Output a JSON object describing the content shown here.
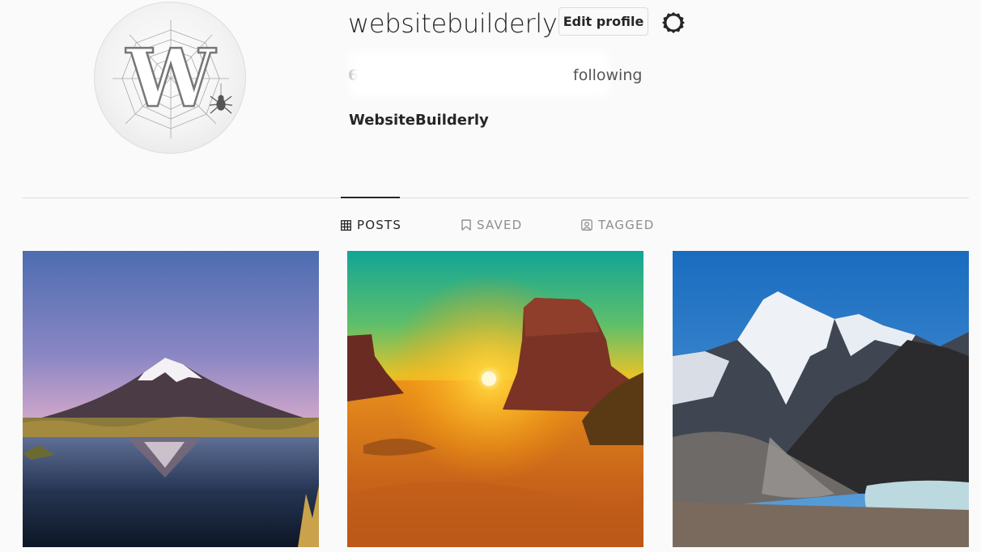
{
  "profile": {
    "username": "websitebuilderly",
    "edit_label": "Edit profile",
    "full_name": "WebsiteBuilderly",
    "avatar_letter": "W",
    "stats": {
      "posts_count": "6",
      "following_label": "following"
    }
  },
  "tabs": [
    {
      "label": "POSTS",
      "icon": "grid-icon",
      "active": true
    },
    {
      "label": "SAVED",
      "icon": "bookmark-icon",
      "active": false
    },
    {
      "label": "TAGGED",
      "icon": "tag-user-icon",
      "active": false
    }
  ],
  "posts": [
    {
      "subject": "snow-capped volcano reflected in lake at dusk"
    },
    {
      "subject": "desert mesa at sunset"
    },
    {
      "subject": "rocky snowy mountains with glacial lake"
    }
  ],
  "colors": {
    "background": "#fafafa",
    "text": "#262626",
    "muted": "#8e8e8e",
    "border": "#dbdbdb"
  }
}
